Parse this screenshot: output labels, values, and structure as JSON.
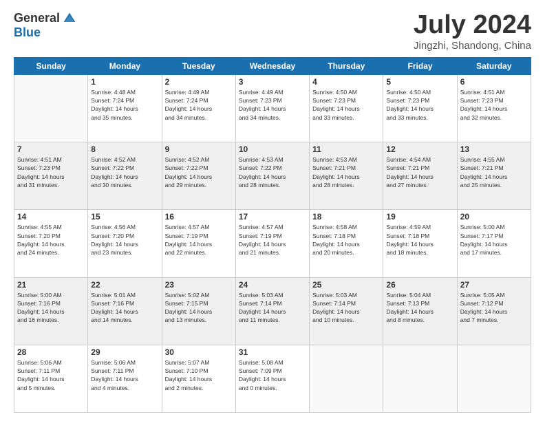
{
  "logo": {
    "general": "General",
    "blue": "Blue"
  },
  "title": "July 2024",
  "location": "Jingzhi, Shandong, China",
  "days_of_week": [
    "Sunday",
    "Monday",
    "Tuesday",
    "Wednesday",
    "Thursday",
    "Friday",
    "Saturday"
  ],
  "weeks": [
    [
      {
        "day": "",
        "info": ""
      },
      {
        "day": "1",
        "info": "Sunrise: 4:48 AM\nSunset: 7:24 PM\nDaylight: 14 hours\nand 35 minutes."
      },
      {
        "day": "2",
        "info": "Sunrise: 4:49 AM\nSunset: 7:24 PM\nDaylight: 14 hours\nand 34 minutes."
      },
      {
        "day": "3",
        "info": "Sunrise: 4:49 AM\nSunset: 7:23 PM\nDaylight: 14 hours\nand 34 minutes."
      },
      {
        "day": "4",
        "info": "Sunrise: 4:50 AM\nSunset: 7:23 PM\nDaylight: 14 hours\nand 33 minutes."
      },
      {
        "day": "5",
        "info": "Sunrise: 4:50 AM\nSunset: 7:23 PM\nDaylight: 14 hours\nand 33 minutes."
      },
      {
        "day": "6",
        "info": "Sunrise: 4:51 AM\nSunset: 7:23 PM\nDaylight: 14 hours\nand 32 minutes."
      }
    ],
    [
      {
        "day": "7",
        "info": "Sunrise: 4:51 AM\nSunset: 7:23 PM\nDaylight: 14 hours\nand 31 minutes."
      },
      {
        "day": "8",
        "info": "Sunrise: 4:52 AM\nSunset: 7:22 PM\nDaylight: 14 hours\nand 30 minutes."
      },
      {
        "day": "9",
        "info": "Sunrise: 4:52 AM\nSunset: 7:22 PM\nDaylight: 14 hours\nand 29 minutes."
      },
      {
        "day": "10",
        "info": "Sunrise: 4:53 AM\nSunset: 7:22 PM\nDaylight: 14 hours\nand 28 minutes."
      },
      {
        "day": "11",
        "info": "Sunrise: 4:53 AM\nSunset: 7:21 PM\nDaylight: 14 hours\nand 28 minutes."
      },
      {
        "day": "12",
        "info": "Sunrise: 4:54 AM\nSunset: 7:21 PM\nDaylight: 14 hours\nand 27 minutes."
      },
      {
        "day": "13",
        "info": "Sunrise: 4:55 AM\nSunset: 7:21 PM\nDaylight: 14 hours\nand 25 minutes."
      }
    ],
    [
      {
        "day": "14",
        "info": "Sunrise: 4:55 AM\nSunset: 7:20 PM\nDaylight: 14 hours\nand 24 minutes."
      },
      {
        "day": "15",
        "info": "Sunrise: 4:56 AM\nSunset: 7:20 PM\nDaylight: 14 hours\nand 23 minutes."
      },
      {
        "day": "16",
        "info": "Sunrise: 4:57 AM\nSunset: 7:19 PM\nDaylight: 14 hours\nand 22 minutes."
      },
      {
        "day": "17",
        "info": "Sunrise: 4:57 AM\nSunset: 7:19 PM\nDaylight: 14 hours\nand 21 minutes."
      },
      {
        "day": "18",
        "info": "Sunrise: 4:58 AM\nSunset: 7:18 PM\nDaylight: 14 hours\nand 20 minutes."
      },
      {
        "day": "19",
        "info": "Sunrise: 4:59 AM\nSunset: 7:18 PM\nDaylight: 14 hours\nand 18 minutes."
      },
      {
        "day": "20",
        "info": "Sunrise: 5:00 AM\nSunset: 7:17 PM\nDaylight: 14 hours\nand 17 minutes."
      }
    ],
    [
      {
        "day": "21",
        "info": "Sunrise: 5:00 AM\nSunset: 7:16 PM\nDaylight: 14 hours\nand 16 minutes."
      },
      {
        "day": "22",
        "info": "Sunrise: 5:01 AM\nSunset: 7:16 PM\nDaylight: 14 hours\nand 14 minutes."
      },
      {
        "day": "23",
        "info": "Sunrise: 5:02 AM\nSunset: 7:15 PM\nDaylight: 14 hours\nand 13 minutes."
      },
      {
        "day": "24",
        "info": "Sunrise: 5:03 AM\nSunset: 7:14 PM\nDaylight: 14 hours\nand 11 minutes."
      },
      {
        "day": "25",
        "info": "Sunrise: 5:03 AM\nSunset: 7:14 PM\nDaylight: 14 hours\nand 10 minutes."
      },
      {
        "day": "26",
        "info": "Sunrise: 5:04 AM\nSunset: 7:13 PM\nDaylight: 14 hours\nand 8 minutes."
      },
      {
        "day": "27",
        "info": "Sunrise: 5:05 AM\nSunset: 7:12 PM\nDaylight: 14 hours\nand 7 minutes."
      }
    ],
    [
      {
        "day": "28",
        "info": "Sunrise: 5:06 AM\nSunset: 7:11 PM\nDaylight: 14 hours\nand 5 minutes."
      },
      {
        "day": "29",
        "info": "Sunrise: 5:06 AM\nSunset: 7:11 PM\nDaylight: 14 hours\nand 4 minutes."
      },
      {
        "day": "30",
        "info": "Sunrise: 5:07 AM\nSunset: 7:10 PM\nDaylight: 14 hours\nand 2 minutes."
      },
      {
        "day": "31",
        "info": "Sunrise: 5:08 AM\nSunset: 7:09 PM\nDaylight: 14 hours\nand 0 minutes."
      },
      {
        "day": "",
        "info": ""
      },
      {
        "day": "",
        "info": ""
      },
      {
        "day": "",
        "info": ""
      }
    ]
  ]
}
